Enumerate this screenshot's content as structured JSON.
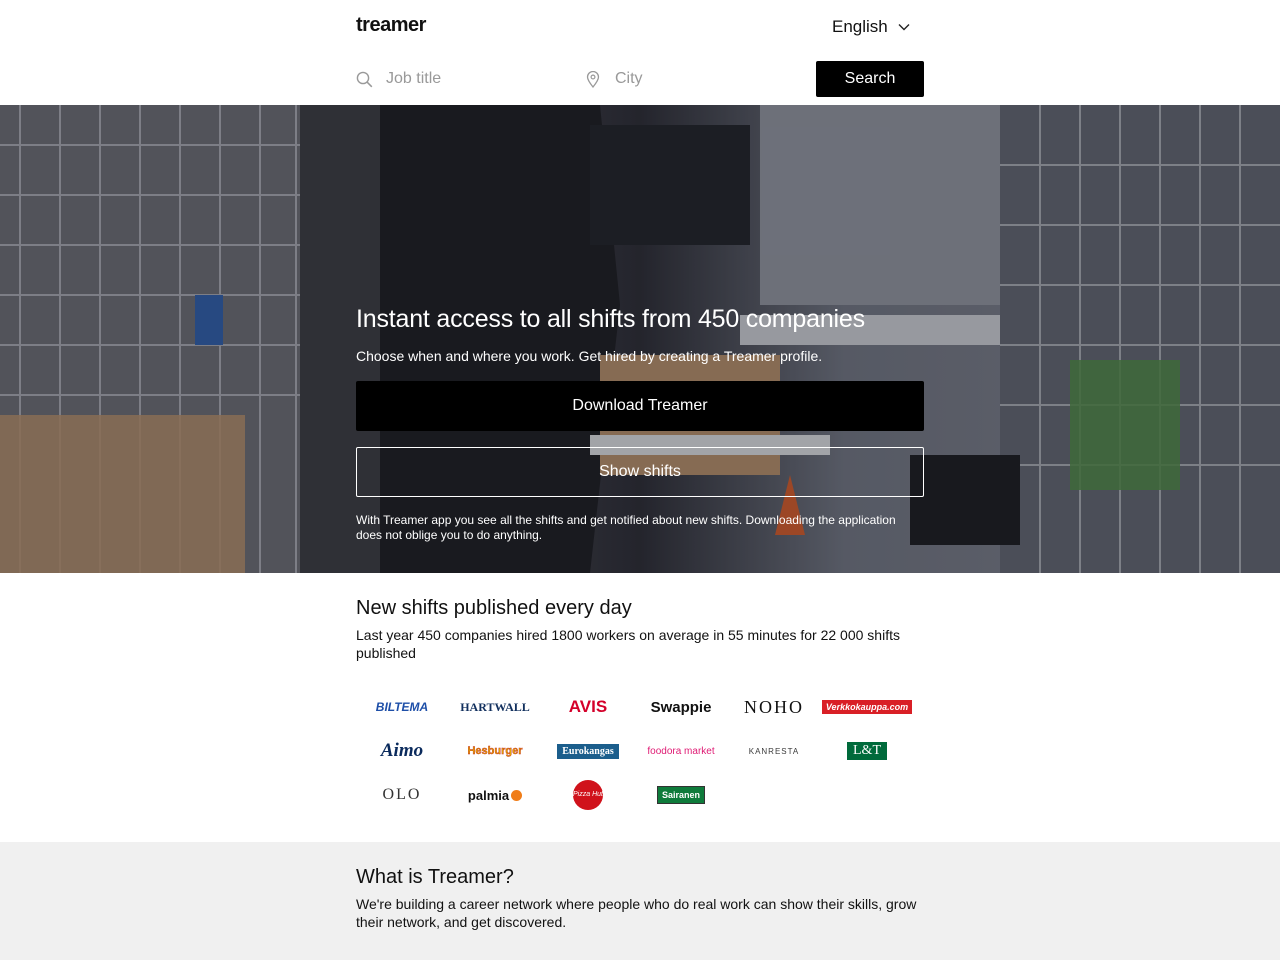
{
  "header": {
    "logo": "treamer",
    "language": "English"
  },
  "search": {
    "job_placeholder": "Job title",
    "city_placeholder": "City",
    "button": "Search"
  },
  "hero": {
    "title": "Instant access to all shifts from 450 companies",
    "subtitle": "Choose when and where you work. Get hired by creating a Treamer profile.",
    "download_button": "Download Treamer",
    "shifts_button": "Show shifts",
    "fine_print": "With Treamer app you see all the shifts and get notified about new shifts. Downloading the application does not oblige you to do anything."
  },
  "shifts_section": {
    "title": "New shifts published every day",
    "description": "Last year 450 companies hired 1800 workers on average in 55 minutes for 22 000 shifts published",
    "brands_row1": [
      "BILTEMA",
      "HARTWALL",
      "AVIS",
      "Swappie",
      "NOHO",
      "Verkkokauppa.com"
    ],
    "brands_row2": [
      "Aimo",
      "Hesburger",
      "Eurokangas",
      "foodora market",
      "KANRESTA",
      "L&T"
    ],
    "brands_row3": [
      "OLO",
      "palmia",
      "Pizza Hut",
      "Sairanen"
    ]
  },
  "what_section": {
    "title": "What is Treamer?",
    "description": "We're building a career network where people who do real work can show their skills, grow their network, and get discovered."
  }
}
